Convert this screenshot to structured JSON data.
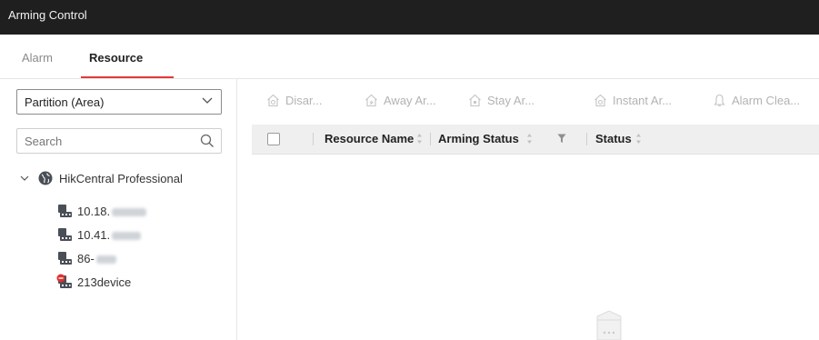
{
  "window": {
    "title": "Arming Control"
  },
  "tabs": [
    {
      "label": "Alarm",
      "active": false
    },
    {
      "label": "Resource",
      "active": true
    }
  ],
  "accent_color": "#e33a3a",
  "left": {
    "dropdown": {
      "selected": "Partition (Area)"
    },
    "search": {
      "placeholder": "Search"
    },
    "tree": {
      "root": {
        "label": "HikCentral Professional",
        "icon": "globe-icon",
        "expanded": true
      },
      "children": [
        {
          "label": "10.18.",
          "icon": "device-icon",
          "redacted": true
        },
        {
          "label": "10.41.",
          "icon": "device-icon",
          "redacted": true
        },
        {
          "label": "86-",
          "icon": "device-icon",
          "redacted": true
        },
        {
          "label": "213device",
          "icon": "device-offline-icon",
          "redacted": false
        }
      ]
    }
  },
  "toolbar": {
    "buttons": [
      {
        "label": "Disar...",
        "icon": "home-icon"
      },
      {
        "label": "Away Ar...",
        "icon": "away-home-icon"
      },
      {
        "label": "Stay Ar...",
        "icon": "home-icon"
      },
      {
        "label": "Instant Ar...",
        "icon": "home-icon"
      },
      {
        "label": "Alarm Clea...",
        "icon": "bell-clear-icon"
      }
    ]
  },
  "grid": {
    "columns": [
      {
        "label": "Resource Name",
        "sortable": true
      },
      {
        "label": "Arming Status",
        "sortable": true,
        "filterable": true
      },
      {
        "label": "Status",
        "sortable": true
      }
    ],
    "rows": []
  }
}
